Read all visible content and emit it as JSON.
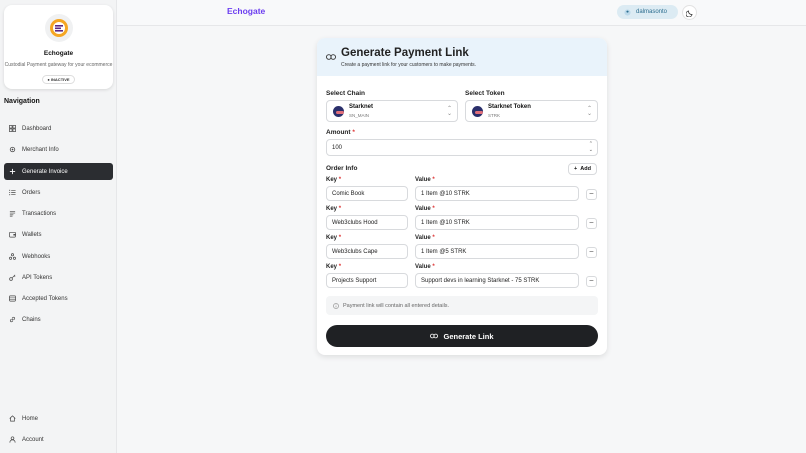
{
  "brand": {
    "name": "Echogate",
    "description": "Custodial Payment gateway for your ecommerce",
    "status": "INACTIVE"
  },
  "navigation": {
    "title": "Navigation",
    "items": [
      {
        "label": "Dashboard",
        "icon": "grid-icon"
      },
      {
        "label": "Merchant Info",
        "icon": "gear-icon"
      },
      {
        "label": "Generate Invoice",
        "icon": "plus-icon",
        "active": true
      },
      {
        "label": "Orders",
        "icon": "list-icon"
      },
      {
        "label": "Transactions",
        "icon": "transactions-icon"
      },
      {
        "label": "Wallets",
        "icon": "wallet-icon"
      },
      {
        "label": "Webhooks",
        "icon": "webhook-icon"
      },
      {
        "label": "API Tokens",
        "icon": "key-icon"
      },
      {
        "label": "Accepted Tokens",
        "icon": "token-icon"
      },
      {
        "label": "Chains",
        "icon": "link-icon"
      }
    ],
    "bottom_items": [
      {
        "label": "Home",
        "icon": "home-icon"
      },
      {
        "label": "Account",
        "icon": "user-icon"
      }
    ]
  },
  "header": {
    "title": "Echogate",
    "user": "dalmasonto"
  },
  "form": {
    "title": "Generate Payment Link",
    "subtitle": "Create a payment link for your customers to make payments.",
    "chain_label": "Select Chain",
    "chain": {
      "name": "Starknet",
      "sub": "SN_MAIN"
    },
    "token_label": "Select Token",
    "token": {
      "name": "Starknet Token",
      "sub": "STRK"
    },
    "amount_label": "Amount",
    "amount_value": "100",
    "order_info_label": "Order Info",
    "add_label": "Add",
    "key_label": "Key",
    "value_label": "Value",
    "rows": [
      {
        "key": "Comic Book",
        "value": "1 Item @10 STRK"
      },
      {
        "key": "Web3clubs Hood",
        "value": "1 Item @10 STRK"
      },
      {
        "key": "Web3clubs Cape",
        "value": "1 Item @5 STRK"
      },
      {
        "key": "Projects Support",
        "value": "Support devs in learning Starknet - 75 STRK"
      }
    ],
    "note": "Payment link will contain all entered details.",
    "submit_label": "Generate Link"
  },
  "colors": {
    "accent": "#6b3df0",
    "primary_button": "#1f2124",
    "header_bg": "#e9f3fb"
  }
}
